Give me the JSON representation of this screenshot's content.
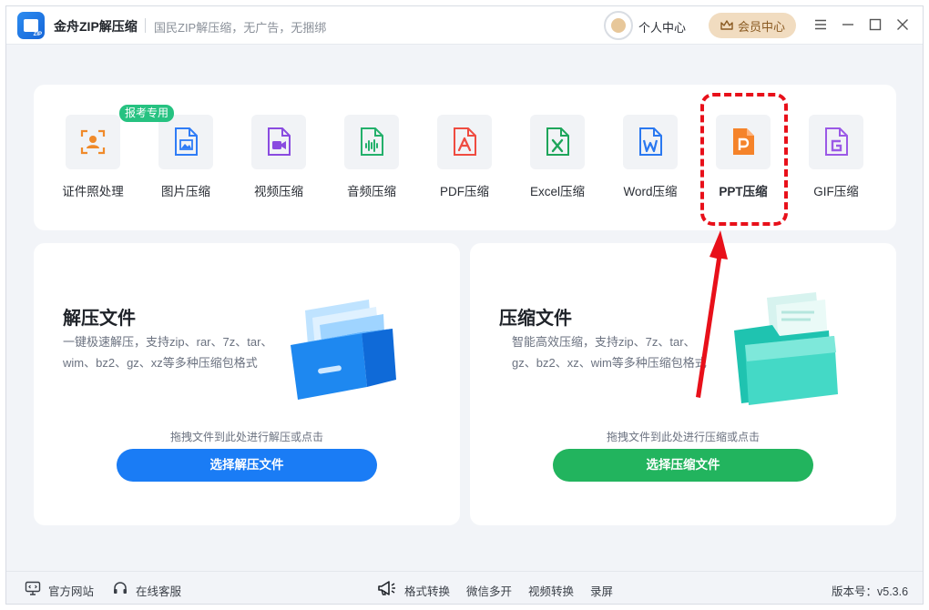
{
  "app": {
    "title": "金舟ZIP解压缩",
    "slogan": "国民ZIP解压缩，无广告，无捆绑",
    "logo_text": "ZIP"
  },
  "header": {
    "personal_center": "个人中心",
    "vip_center": "会员中心"
  },
  "tools": [
    {
      "label": "证件照处理",
      "icon": "id-photo-icon",
      "color": "#f08a2a",
      "badge": "报考专用"
    },
    {
      "label": "图片压缩",
      "icon": "image-file-icon",
      "color": "#2f7cf6"
    },
    {
      "label": "视频压缩",
      "icon": "video-file-icon",
      "color": "#8a4be0"
    },
    {
      "label": "音频压缩",
      "icon": "audio-file-icon",
      "color": "#23b06b"
    },
    {
      "label": "PDF压缩",
      "icon": "pdf-file-icon",
      "color": "#ef4b40"
    },
    {
      "label": "Excel压缩",
      "icon": "excel-file-icon",
      "color": "#1ea55a"
    },
    {
      "label": "Word压缩",
      "icon": "word-file-icon",
      "color": "#2a78f0"
    },
    {
      "label": "PPT压缩",
      "icon": "ppt-file-icon",
      "color": "#f5832a"
    },
    {
      "label": "GIF压缩",
      "icon": "gif-file-icon",
      "color": "#9b59e6"
    }
  ],
  "cards": {
    "extract": {
      "title": "解压文件",
      "description": "一键极速解压，支持zip、rar、7z、tar、wim、bz2、gz、xz等多种压缩包格式",
      "hint": "拖拽文件到此处进行解压或点击",
      "button": "选择解压文件",
      "button_color": "#1a7cf5"
    },
    "compress": {
      "title": "压缩文件",
      "description": "智能高效压缩，支持zip、7z、tar、gz、bz2、xz、wim等多种压缩包格式",
      "hint": "拖拽文件到此处进行压缩或点击",
      "button": "选择压缩文件",
      "button_color": "#22b45e"
    }
  },
  "statusbar": {
    "website": "官方网站",
    "support": "在线客服",
    "format_convert": "格式转换",
    "wechat_multi": "微信多开",
    "video_convert": "视频转换",
    "record": "录屏",
    "version": "版本号：v5.3.6"
  },
  "annotation": {
    "highlight_color": "#e8101a",
    "target": "PPT压缩"
  }
}
